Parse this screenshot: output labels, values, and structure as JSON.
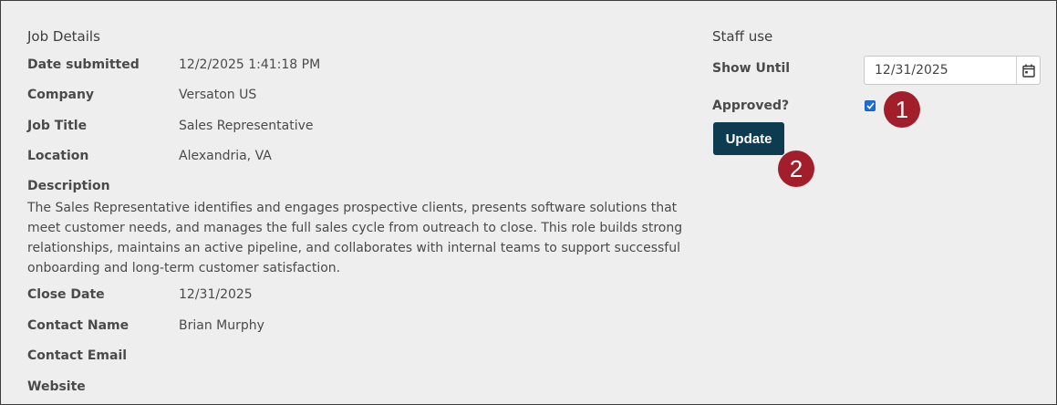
{
  "job_details": {
    "title": "Job Details",
    "fields": [
      {
        "label": "Date submitted",
        "value": "12/2/2025 1:41:18 PM"
      },
      {
        "label": "Company",
        "value": "Versaton US"
      },
      {
        "label": "Job Title",
        "value": "Sales Representative"
      },
      {
        "label": "Location",
        "value": "Alexandria, VA"
      }
    ],
    "description": {
      "label": "Description",
      "text": "The Sales Representative identifies and engages prospective clients, presents software solutions that meet customer needs, and manages the full sales cycle from outreach to close. This role builds strong relationships, maintains an active pipeline, and collaborates with internal teams to support successful onboarding and long-term customer satisfaction."
    },
    "fields_after": [
      {
        "label": "Close Date",
        "value": "12/31/2025"
      },
      {
        "label": "Contact Name",
        "value": "Brian Murphy"
      },
      {
        "label": "Contact Email",
        "value": ""
      },
      {
        "label": "Website",
        "value": ""
      }
    ]
  },
  "staff_use": {
    "title": "Staff use",
    "show_until_label": "Show Until",
    "show_until_value": "12/31/2025",
    "approved_label": "Approved?",
    "approved_checked": true,
    "update_label": "Update"
  },
  "markers": [
    "1",
    "2"
  ],
  "colors": {
    "panel_bg": "#eeeeee",
    "button_bg": "#0d3b4f",
    "marker_bg": "#a11e2a",
    "checkbox": "#1a6fd6"
  },
  "icons": {
    "calendar": "calendar-icon",
    "check": "checkmark-icon"
  }
}
